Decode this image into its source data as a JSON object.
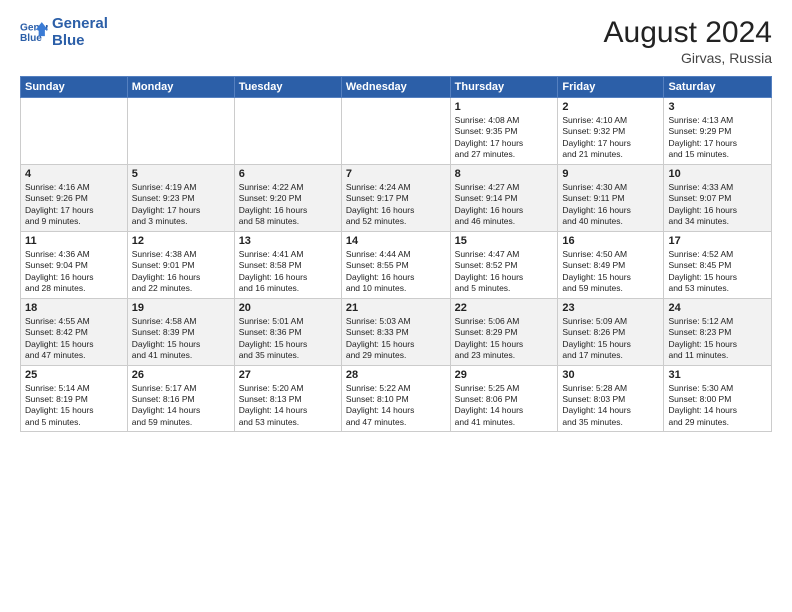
{
  "header": {
    "logo_line1": "General",
    "logo_line2": "Blue",
    "month_year": "August 2024",
    "location": "Girvas, Russia"
  },
  "weekdays": [
    "Sunday",
    "Monday",
    "Tuesday",
    "Wednesday",
    "Thursday",
    "Friday",
    "Saturday"
  ],
  "weeks": [
    [
      {
        "day": "",
        "info": ""
      },
      {
        "day": "",
        "info": ""
      },
      {
        "day": "",
        "info": ""
      },
      {
        "day": "",
        "info": ""
      },
      {
        "day": "1",
        "info": "Sunrise: 4:08 AM\nSunset: 9:35 PM\nDaylight: 17 hours\nand 27 minutes."
      },
      {
        "day": "2",
        "info": "Sunrise: 4:10 AM\nSunset: 9:32 PM\nDaylight: 17 hours\nand 21 minutes."
      },
      {
        "day": "3",
        "info": "Sunrise: 4:13 AM\nSunset: 9:29 PM\nDaylight: 17 hours\nand 15 minutes."
      }
    ],
    [
      {
        "day": "4",
        "info": "Sunrise: 4:16 AM\nSunset: 9:26 PM\nDaylight: 17 hours\nand 9 minutes."
      },
      {
        "day": "5",
        "info": "Sunrise: 4:19 AM\nSunset: 9:23 PM\nDaylight: 17 hours\nand 3 minutes."
      },
      {
        "day": "6",
        "info": "Sunrise: 4:22 AM\nSunset: 9:20 PM\nDaylight: 16 hours\nand 58 minutes."
      },
      {
        "day": "7",
        "info": "Sunrise: 4:24 AM\nSunset: 9:17 PM\nDaylight: 16 hours\nand 52 minutes."
      },
      {
        "day": "8",
        "info": "Sunrise: 4:27 AM\nSunset: 9:14 PM\nDaylight: 16 hours\nand 46 minutes."
      },
      {
        "day": "9",
        "info": "Sunrise: 4:30 AM\nSunset: 9:11 PM\nDaylight: 16 hours\nand 40 minutes."
      },
      {
        "day": "10",
        "info": "Sunrise: 4:33 AM\nSunset: 9:07 PM\nDaylight: 16 hours\nand 34 minutes."
      }
    ],
    [
      {
        "day": "11",
        "info": "Sunrise: 4:36 AM\nSunset: 9:04 PM\nDaylight: 16 hours\nand 28 minutes."
      },
      {
        "day": "12",
        "info": "Sunrise: 4:38 AM\nSunset: 9:01 PM\nDaylight: 16 hours\nand 22 minutes."
      },
      {
        "day": "13",
        "info": "Sunrise: 4:41 AM\nSunset: 8:58 PM\nDaylight: 16 hours\nand 16 minutes."
      },
      {
        "day": "14",
        "info": "Sunrise: 4:44 AM\nSunset: 8:55 PM\nDaylight: 16 hours\nand 10 minutes."
      },
      {
        "day": "15",
        "info": "Sunrise: 4:47 AM\nSunset: 8:52 PM\nDaylight: 16 hours\nand 5 minutes."
      },
      {
        "day": "16",
        "info": "Sunrise: 4:50 AM\nSunset: 8:49 PM\nDaylight: 15 hours\nand 59 minutes."
      },
      {
        "day": "17",
        "info": "Sunrise: 4:52 AM\nSunset: 8:45 PM\nDaylight: 15 hours\nand 53 minutes."
      }
    ],
    [
      {
        "day": "18",
        "info": "Sunrise: 4:55 AM\nSunset: 8:42 PM\nDaylight: 15 hours\nand 47 minutes."
      },
      {
        "day": "19",
        "info": "Sunrise: 4:58 AM\nSunset: 8:39 PM\nDaylight: 15 hours\nand 41 minutes."
      },
      {
        "day": "20",
        "info": "Sunrise: 5:01 AM\nSunset: 8:36 PM\nDaylight: 15 hours\nand 35 minutes."
      },
      {
        "day": "21",
        "info": "Sunrise: 5:03 AM\nSunset: 8:33 PM\nDaylight: 15 hours\nand 29 minutes."
      },
      {
        "day": "22",
        "info": "Sunrise: 5:06 AM\nSunset: 8:29 PM\nDaylight: 15 hours\nand 23 minutes."
      },
      {
        "day": "23",
        "info": "Sunrise: 5:09 AM\nSunset: 8:26 PM\nDaylight: 15 hours\nand 17 minutes."
      },
      {
        "day": "24",
        "info": "Sunrise: 5:12 AM\nSunset: 8:23 PM\nDaylight: 15 hours\nand 11 minutes."
      }
    ],
    [
      {
        "day": "25",
        "info": "Sunrise: 5:14 AM\nSunset: 8:19 PM\nDaylight: 15 hours\nand 5 minutes."
      },
      {
        "day": "26",
        "info": "Sunrise: 5:17 AM\nSunset: 8:16 PM\nDaylight: 14 hours\nand 59 minutes."
      },
      {
        "day": "27",
        "info": "Sunrise: 5:20 AM\nSunset: 8:13 PM\nDaylight: 14 hours\nand 53 minutes."
      },
      {
        "day": "28",
        "info": "Sunrise: 5:22 AM\nSunset: 8:10 PM\nDaylight: 14 hours\nand 47 minutes."
      },
      {
        "day": "29",
        "info": "Sunrise: 5:25 AM\nSunset: 8:06 PM\nDaylight: 14 hours\nand 41 minutes."
      },
      {
        "day": "30",
        "info": "Sunrise: 5:28 AM\nSunset: 8:03 PM\nDaylight: 14 hours\nand 35 minutes."
      },
      {
        "day": "31",
        "info": "Sunrise: 5:30 AM\nSunset: 8:00 PM\nDaylight: 14 hours\nand 29 minutes."
      }
    ]
  ]
}
